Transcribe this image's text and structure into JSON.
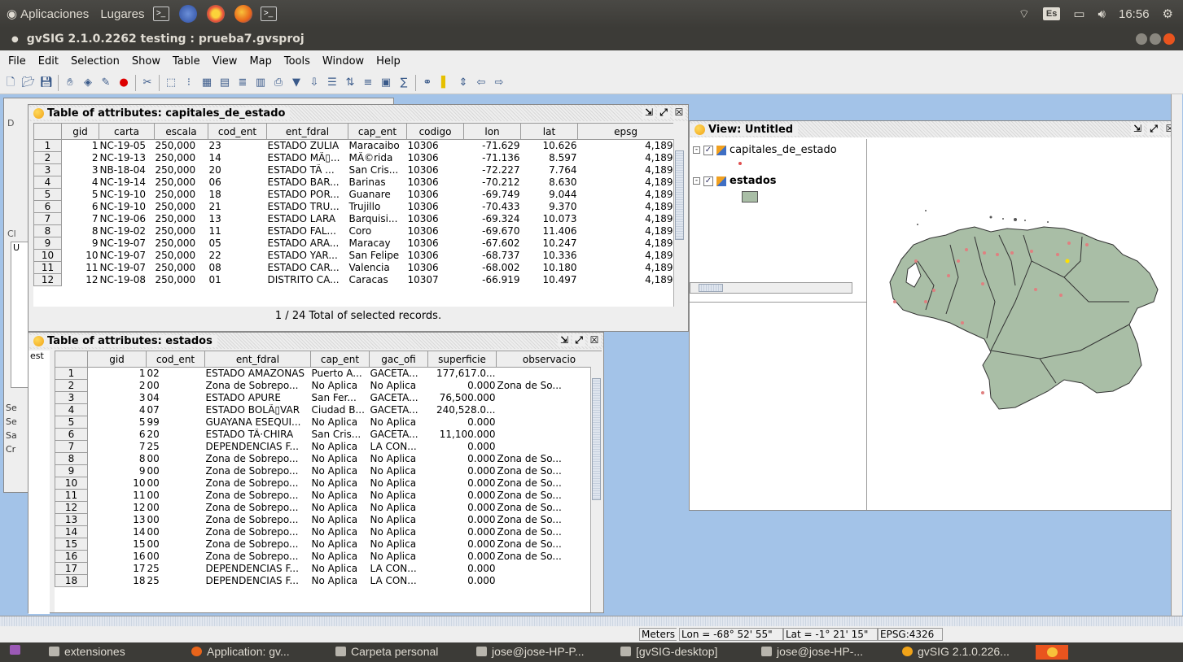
{
  "topbar": {
    "applications": "Aplicaciones",
    "places": "Lugares",
    "lang": "Es",
    "clock": "16:56"
  },
  "window": {
    "title": "gvSIG 2.1.0.2262 testing : prueba7.gvsproj"
  },
  "menu": [
    "File",
    "Edit",
    "Selection",
    "Show",
    "Table",
    "View",
    "Map",
    "Tools",
    "Window",
    "Help"
  ],
  "table1": {
    "title": "Table of attributes: capitales_de_estado",
    "columns": [
      "gid",
      "carta",
      "escala",
      "cod_ent",
      "ent_fdral",
      "cap_ent",
      "codigo",
      "lon",
      "lat",
      "epsg"
    ],
    "rows": [
      [
        "1",
        "1",
        "NC-19-05",
        "250,000",
        "23",
        "ESTADO ZULIA",
        "Maracaibo",
        "10306",
        "-71.629",
        "10.626",
        "4,189"
      ],
      [
        "2",
        "2",
        "NC-19-13",
        "250,000",
        "14",
        "ESTADO MÃ▯...",
        "MÃ©rida",
        "10306",
        "-71.136",
        "8.597",
        "4,189"
      ],
      [
        "3",
        "3",
        "NB-18-04",
        "250,000",
        "20",
        "ESTADO TÃ ...",
        "San Cris...",
        "10306",
        "-72.227",
        "7.764",
        "4,189"
      ],
      [
        "4",
        "4",
        "NC-19-14",
        "250,000",
        "06",
        "ESTADO BAR...",
        "Barinas",
        "10306",
        "-70.212",
        "8.630",
        "4,189"
      ],
      [
        "5",
        "5",
        "NC-19-10",
        "250,000",
        "18",
        "ESTADO POR...",
        "Guanare",
        "10306",
        "-69.749",
        "9.044",
        "4,189"
      ],
      [
        "6",
        "6",
        "NC-19-10",
        "250,000",
        "21",
        "ESTADO TRU...",
        "Trujillo",
        "10306",
        "-70.433",
        "9.370",
        "4,189"
      ],
      [
        "7",
        "7",
        "NC-19-06",
        "250,000",
        "13",
        "ESTADO LARA",
        "Barquisi...",
        "10306",
        "-69.324",
        "10.073",
        "4,189"
      ],
      [
        "8",
        "8",
        "NC-19-02",
        "250,000",
        "11",
        "ESTADO FAL...",
        "Coro",
        "10306",
        "-69.670",
        "11.406",
        "4,189"
      ],
      [
        "9",
        "9",
        "NC-19-07",
        "250,000",
        "05",
        "ESTADO ARA...",
        "Maracay",
        "10306",
        "-67.602",
        "10.247",
        "4,189"
      ],
      [
        "10",
        "10",
        "NC-19-07",
        "250,000",
        "22",
        "ESTADO YAR...",
        "San Felipe",
        "10306",
        "-68.737",
        "10.336",
        "4,189"
      ],
      [
        "11",
        "11",
        "NC-19-07",
        "250,000",
        "08",
        "ESTADO CAR...",
        "Valencia",
        "10306",
        "-68.002",
        "10.180",
        "4,189"
      ],
      [
        "12",
        "12",
        "NC-19-08",
        "250,000",
        "01",
        "DISTRITO CA...",
        "Caracas",
        "10307",
        "-66.919",
        "10.497",
        "4,189"
      ]
    ],
    "status": "1 / 24 Total of selected records."
  },
  "table2": {
    "title": "Table of attributes: estados",
    "side_label": "est",
    "columns": [
      "gid",
      "cod_ent",
      "ent_fdral",
      "cap_ent",
      "gac_ofi",
      "superficie",
      "observacio"
    ],
    "rows": [
      [
        "1",
        "1",
        "02",
        "ESTADO AMAZONAS",
        "Puerto A...",
        "GACETA...",
        "177,617.0...",
        ""
      ],
      [
        "2",
        "2",
        "00",
        "Zona de Sobrepo...",
        "No Aplica",
        "No Aplica",
        "0.000",
        "Zona de So..."
      ],
      [
        "3",
        "3",
        "04",
        "ESTADO APURE",
        "San Fer...",
        "GACETA...",
        "76,500.000",
        ""
      ],
      [
        "4",
        "4",
        "07",
        "ESTADO BOLÃ▯VAR",
        "Ciudad B...",
        "GACETA...",
        "240,528.0...",
        ""
      ],
      [
        "5",
        "5",
        "99",
        "GUAYANA ESEQUI...",
        "No Aplica",
        "No Aplica",
        "0.000",
        ""
      ],
      [
        "6",
        "6",
        "20",
        "ESTADO TÃ·CHIRA",
        "San Cris...",
        "GACETA...",
        "11,100.000",
        ""
      ],
      [
        "7",
        "7",
        "25",
        "DEPENDENCIAS F...",
        "No Aplica",
        "LA CON...",
        "0.000",
        ""
      ],
      [
        "8",
        "8",
        "00",
        "Zona de Sobrepo...",
        "No Aplica",
        "No Aplica",
        "0.000",
        "Zona de So..."
      ],
      [
        "9",
        "9",
        "00",
        "Zona de Sobrepo...",
        "No Aplica",
        "No Aplica",
        "0.000",
        "Zona de So..."
      ],
      [
        "10",
        "10",
        "00",
        "Zona de Sobrepo...",
        "No Aplica",
        "No Aplica",
        "0.000",
        "Zona de So..."
      ],
      [
        "11",
        "11",
        "00",
        "Zona de Sobrepo...",
        "No Aplica",
        "No Aplica",
        "0.000",
        "Zona de So..."
      ],
      [
        "12",
        "12",
        "00",
        "Zona de Sobrepo...",
        "No Aplica",
        "No Aplica",
        "0.000",
        "Zona de So..."
      ],
      [
        "13",
        "13",
        "00",
        "Zona de Sobrepo...",
        "No Aplica",
        "No Aplica",
        "0.000",
        "Zona de So..."
      ],
      [
        "14",
        "14",
        "00",
        "Zona de Sobrepo...",
        "No Aplica",
        "No Aplica",
        "0.000",
        "Zona de So..."
      ],
      [
        "15",
        "15",
        "00",
        "Zona de Sobrepo...",
        "No Aplica",
        "No Aplica",
        "0.000",
        "Zona de So..."
      ],
      [
        "16",
        "16",
        "00",
        "Zona de Sobrepo...",
        "No Aplica",
        "No Aplica",
        "0.000",
        "Zona de So..."
      ],
      [
        "17",
        "17",
        "25",
        "DEPENDENCIAS F...",
        "No Aplica",
        "LA CON...",
        "0.000",
        ""
      ],
      [
        "18",
        "18",
        "25",
        "DEPENDENCIAS F...",
        "No Aplica",
        "LA CON...",
        "0.000",
        ""
      ]
    ]
  },
  "view": {
    "title": "View: Untitled",
    "layers": [
      {
        "name": "capitales_de_estado",
        "checked": true
      },
      {
        "name": "estados",
        "checked": true
      }
    ],
    "fill_color": "#a9bea6"
  },
  "project_panel": {
    "labels": [
      "D",
      "Cl",
      "U",
      "Se",
      "Se",
      "Sa",
      "Cr"
    ]
  },
  "statusbar": {
    "units": "Meters",
    "lon": "Lon = -68° 52' 55\"",
    "lat": "Lat = -1° 21' 15\"",
    "epsg": "EPSG:4326"
  },
  "taskbar": [
    "extensiones",
    "Application: gv...",
    "Carpeta personal",
    "jose@jose-HP-P...",
    "[gvSIG-desktop]",
    "jose@jose-HP-...",
    "gvSIG 2.1.0.226..."
  ]
}
